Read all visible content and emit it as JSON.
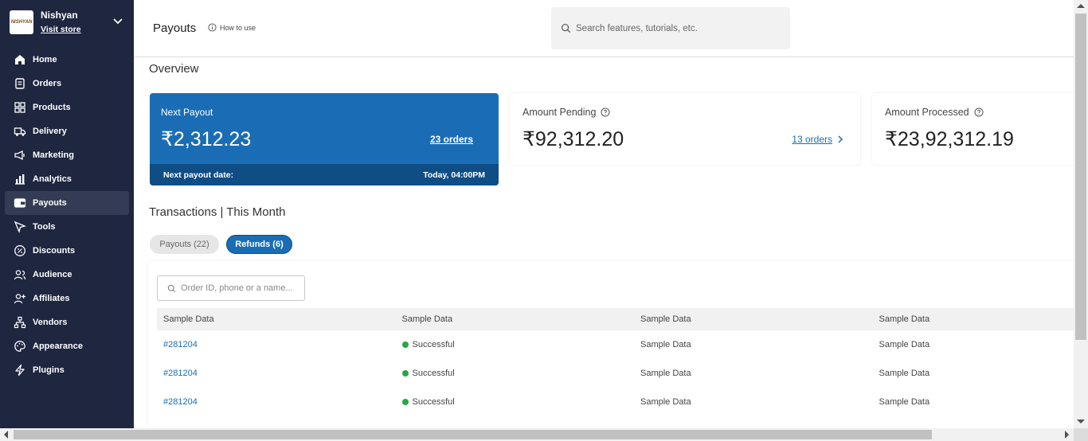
{
  "store": {
    "name": "Nishyan",
    "logo_text": "NISHYAN",
    "visit_label": "Visit store"
  },
  "sidebar": {
    "items": [
      {
        "label": "Home",
        "icon": "home-icon"
      },
      {
        "label": "Orders",
        "icon": "orders-icon"
      },
      {
        "label": "Products",
        "icon": "products-icon"
      },
      {
        "label": "Delivery",
        "icon": "truck-icon"
      },
      {
        "label": "Marketing",
        "icon": "megaphone-icon"
      },
      {
        "label": "Analytics",
        "icon": "bar-chart-icon"
      },
      {
        "label": "Payouts",
        "icon": "wallet-icon",
        "active": true
      },
      {
        "label": "Tools",
        "icon": "cursor-icon"
      },
      {
        "label": "Discounts",
        "icon": "discount-icon"
      },
      {
        "label": "Audience",
        "icon": "users-icon"
      },
      {
        "label": "Affiliates",
        "icon": "user-plus-icon"
      },
      {
        "label": "Vendors",
        "icon": "network-icon"
      },
      {
        "label": "Appearance",
        "icon": "palette-icon"
      },
      {
        "label": "Plugins",
        "icon": "bolt-icon"
      }
    ]
  },
  "header": {
    "title": "Payouts",
    "how_to": "How to use",
    "search_placeholder": "Search features, tutorials, etc."
  },
  "overview": {
    "title": "Overview",
    "next_payout": {
      "label": "Next Payout",
      "amount": "₹2,312.23",
      "orders": "23 orders",
      "date_label": "Next payout date:",
      "date_value": "Today, 04:00PM"
    },
    "pending": {
      "label": "Amount Pending",
      "amount": "₹92,312.20",
      "orders": "13 orders"
    },
    "processed": {
      "label": "Amount Processed",
      "amount": "₹23,92,312.19"
    }
  },
  "transactions": {
    "title": "Transactions | This Month",
    "tabs": [
      {
        "label": "Payouts (22)",
        "active": false
      },
      {
        "label": "Refunds (6)",
        "active": true
      }
    ],
    "search_placeholder": "Order ID, phone or a name...",
    "columns": [
      "Sample Data",
      "Sample Data",
      "Sample Data",
      "Sample Data"
    ],
    "rows": [
      {
        "order": "#281204",
        "status": "Successful",
        "c3": "Sample Data",
        "c4": "Sample Data"
      },
      {
        "order": "#281204",
        "status": "Successful",
        "c3": "Sample Data",
        "c4": "Sample Data"
      },
      {
        "order": "#281204",
        "status": "Successful",
        "c3": "Sample Data",
        "c4": "Sample Data"
      }
    ]
  },
  "colors": {
    "sidebar_bg": "#1e2640",
    "accent": "#1a6db5",
    "accent_dark": "#0f4d85",
    "success": "#28a745"
  }
}
